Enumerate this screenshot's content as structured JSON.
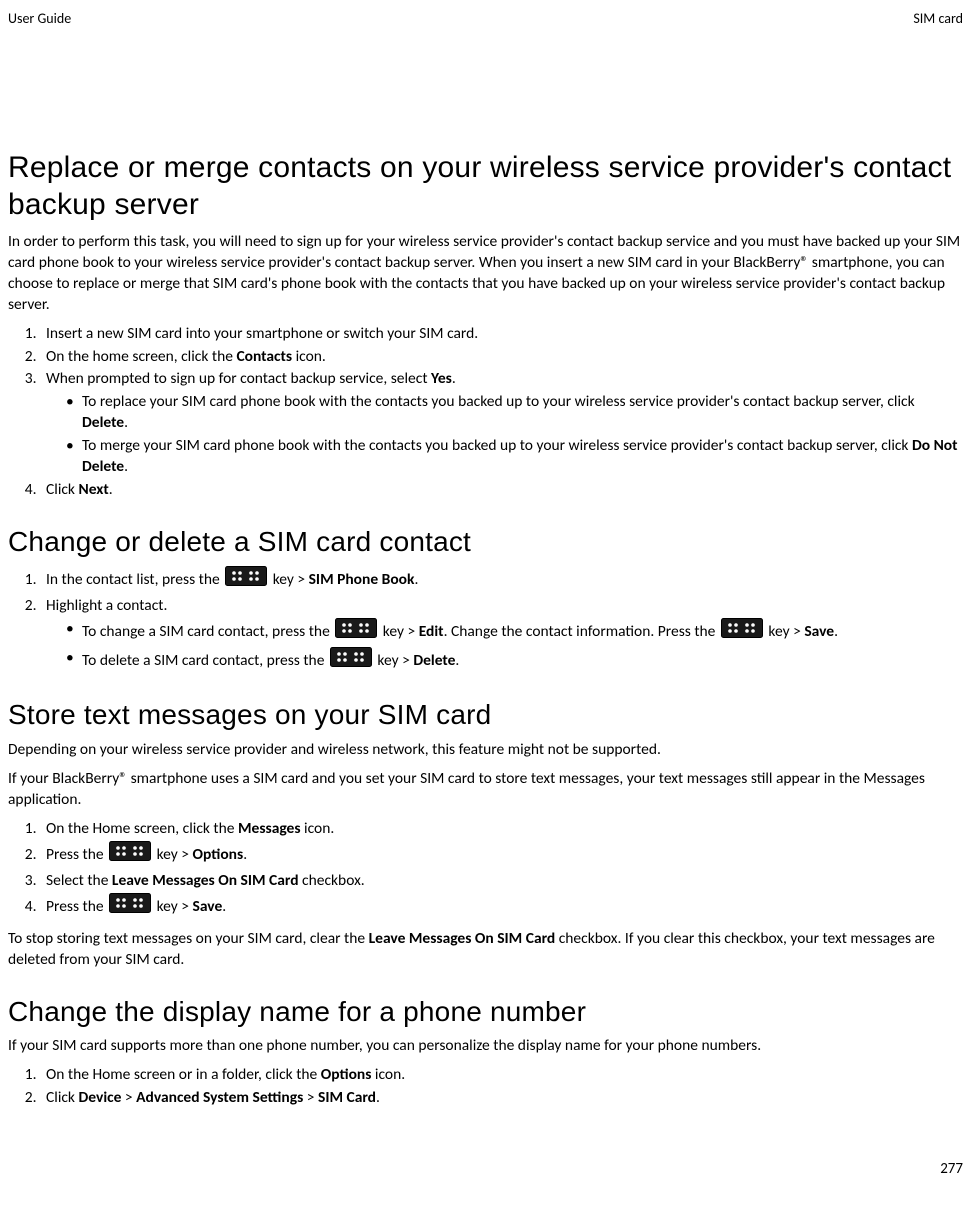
{
  "header": {
    "left": "User Guide",
    "right": "SIM card"
  },
  "section1": {
    "title": "Replace or merge contacts on your wireless service provider's contact backup server",
    "intro": "In order to perform this task, you will need to sign up for your wireless service provider's contact backup service and you must have backed up your SIM card phone book to your wireless service provider's contact backup server. When you insert a new SIM card in your BlackBerry® smartphone, you can choose to replace or merge that SIM card's phone book with the contacts that you have backed up on your wireless service provider's contact backup server.",
    "steps": {
      "s1": "Insert a new SIM card into your smartphone or switch your SIM card.",
      "s2_pre": "On the home screen, click the ",
      "s2_bold": "Contacts",
      "s2_post": " icon.",
      "s3_pre": "When prompted to sign up for contact backup service, select ",
      "s3_bold": "Yes",
      "s3_post": ".",
      "s3_b1_pre": "To replace your SIM card phone book with the contacts you backed up to your wireless service provider's contact backup server, click ",
      "s3_b1_bold": "Delete",
      "s3_b1_post": ".",
      "s3_b2_pre": "To merge your SIM card phone book with the contacts you backed up to your wireless service provider's contact backup server, click ",
      "s3_b2_bold": "Do Not Delete",
      "s3_b2_post": ".",
      "s4_pre": "Click ",
      "s4_bold": "Next",
      "s4_post": "."
    }
  },
  "section2": {
    "title": "Change or delete a SIM card contact",
    "steps": {
      "s1_pre": "In the contact list, press the ",
      "s1_mid": " key > ",
      "s1_bold": "SIM Phone Book",
      "s1_post": ".",
      "s2": "Highlight a contact.",
      "s2_b1_pre": "To change a SIM card contact, press the ",
      "s2_b1_mid1": " key > ",
      "s2_b1_bold1": "Edit",
      "s2_b1_mid2": ". Change the contact information. Press the ",
      "s2_b1_mid3": " key > ",
      "s2_b1_bold2": "Save",
      "s2_b1_post": ".",
      "s2_b2_pre": "To delete a SIM card contact, press the ",
      "s2_b2_mid": " key > ",
      "s2_b2_bold": "Delete",
      "s2_b2_post": "."
    }
  },
  "section3": {
    "title": "Store text messages on your SIM card",
    "p1": "Depending on your wireless service provider and wireless network, this feature might not be supported.",
    "p2": "If your BlackBerry® smartphone uses a SIM card and you set your SIM card to store text messages, your text messages still appear in the Messages application.",
    "steps": {
      "s1_pre": "On the Home screen, click the ",
      "s1_bold": "Messages",
      "s1_post": " icon.",
      "s2_pre": "Press the ",
      "s2_mid": " key > ",
      "s2_bold": "Options",
      "s2_post": ".",
      "s3_pre": "Select the ",
      "s3_bold": "Leave Messages On SIM Card",
      "s3_post": " checkbox.",
      "s4_pre": "Press the ",
      "s4_mid": " key > ",
      "s4_bold": "Save",
      "s4_post": "."
    },
    "p3_pre": "To stop storing text messages on your SIM card, clear the ",
    "p3_bold": "Leave Messages On SIM Card",
    "p3_post": " checkbox. If you clear this checkbox, your text messages are deleted from your SIM card."
  },
  "section4": {
    "title": "Change the display name for a phone number",
    "p1": "If your SIM card supports more than one phone number, you can personalize the display name for your phone numbers.",
    "steps": {
      "s1_pre": "On the Home screen or in a folder, click the ",
      "s1_bold": "Options",
      "s1_post": " icon.",
      "s2_pre": "Click ",
      "s2_b1": "Device",
      "s2_g1": " > ",
      "s2_b2": "Advanced System Settings",
      "s2_g2": " > ",
      "s2_b3": "SIM Card",
      "s2_post": "."
    }
  },
  "footer": {
    "page": "277"
  }
}
